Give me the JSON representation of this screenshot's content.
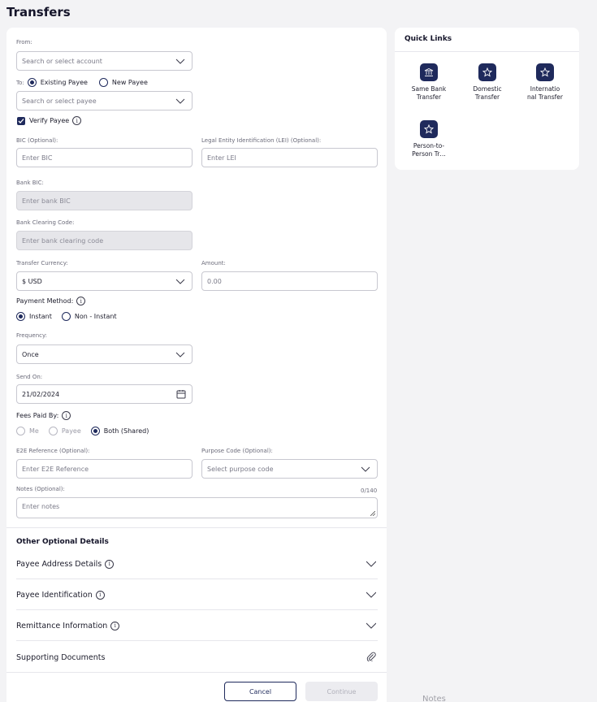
{
  "page": {
    "title": "Transfers"
  },
  "from": {
    "label": "From:",
    "placeholder": "Search or select account"
  },
  "to": {
    "label": "To:",
    "options": [
      "Existing Payee",
      "New Payee"
    ],
    "selected": "Existing Payee",
    "payee_placeholder": "Search or select payee"
  },
  "verify_payee": {
    "label": "Verify Payee",
    "checked": true
  },
  "bic": {
    "label": "BIC (Optional):",
    "placeholder": "Enter BIC"
  },
  "lei": {
    "label": "Legal Entity Identification (LEI) (Optional):",
    "placeholder": "Enter LEI"
  },
  "bank_bic": {
    "label": "Bank BIC:",
    "placeholder": "Enter bank BIC"
  },
  "bank_clearing": {
    "label": "Bank Clearing Code:",
    "placeholder": "Enter bank clearing code"
  },
  "currency": {
    "label": "Transfer Currency:",
    "value": "$ USD"
  },
  "amount": {
    "label": "Amount:",
    "placeholder": "0.00"
  },
  "payment_method": {
    "label": "Payment Method:",
    "options": [
      "Instant",
      "Non - Instant"
    ],
    "selected": "Instant"
  },
  "frequency": {
    "label": "Frequency:",
    "value": "Once"
  },
  "send_on": {
    "label": "Send On:",
    "value": "21/02/2024"
  },
  "fees": {
    "label": "Fees Paid By:",
    "options": [
      "Me",
      "Payee",
      "Both (Shared)"
    ],
    "selected": "Both (Shared)"
  },
  "e2e": {
    "label": "E2E Reference (Optional):",
    "placeholder": "Enter E2E Reference"
  },
  "purpose": {
    "label": "Purpose Code (Optional):",
    "placeholder": "Select purpose code"
  },
  "notes": {
    "label": "Notes (Optional):",
    "counter": "0/140",
    "placeholder": "Enter notes"
  },
  "other_details": {
    "title": "Other Optional Details",
    "sections": [
      "Payee Address Details",
      "Payee Identification",
      "Remittance Information",
      "Supporting Documents"
    ]
  },
  "actions": {
    "cancel": "Cancel",
    "continue": "Continue"
  },
  "quick_links": {
    "title": "Quick Links",
    "items": [
      {
        "line1": "Same Bank",
        "line2": "Transfer",
        "icon": "bank-icon"
      },
      {
        "line1": "Domestic",
        "line2": "Transfer",
        "icon": "star-icon"
      },
      {
        "line1": "Internatio",
        "line2": "nal Transfer",
        "icon": "star-icon"
      },
      {
        "line1": "Person-to-",
        "line2": "Person Tr…",
        "icon": "star-icon"
      }
    ]
  },
  "ghost_text": "Notes",
  "colors": {
    "primary": "#1f2a5c",
    "background": "#f3f3f5",
    "card": "#ffffff"
  }
}
